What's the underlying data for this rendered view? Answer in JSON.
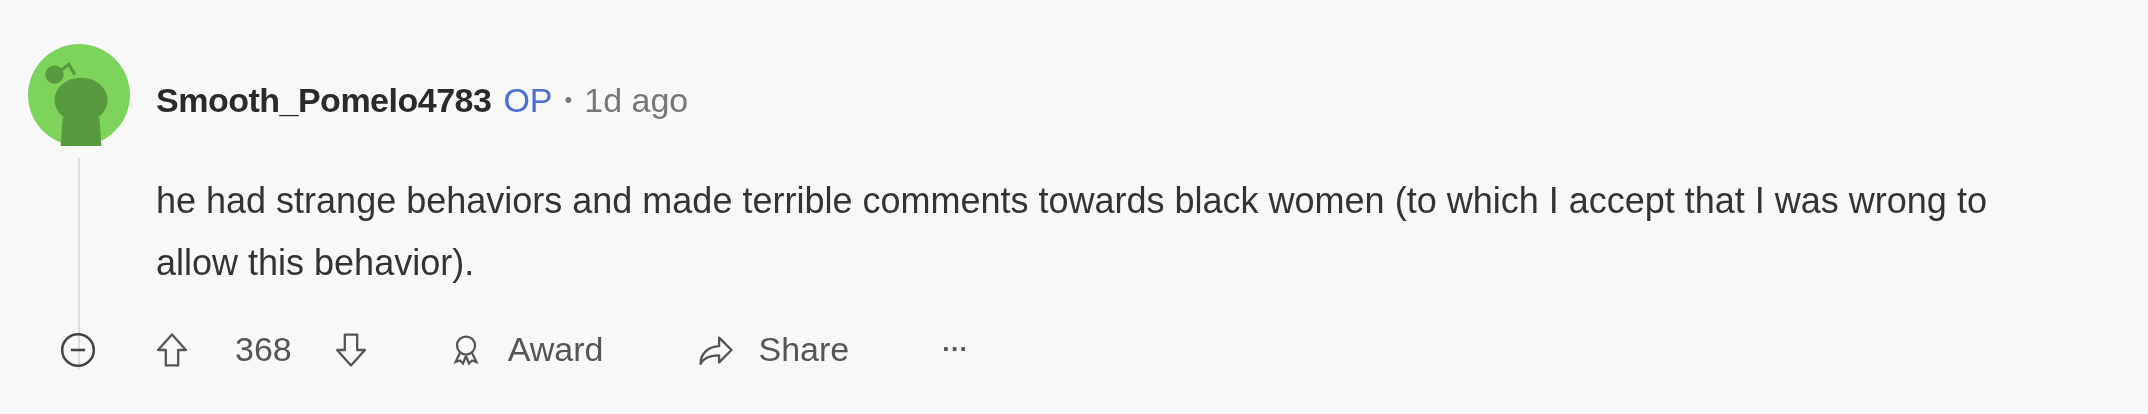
{
  "comment": {
    "author": "Smooth_Pomelo4783",
    "author_badge": "OP",
    "separator": "•",
    "time": "1d ago",
    "body": "he had strange behaviors and made terrible comments towards black women (to which I accept that I was wrong to allow this behavior).",
    "score": "368",
    "actions": [
      {
        "kind": "award",
        "label": "Award"
      },
      {
        "kind": "share",
        "label": "Share"
      },
      {
        "kind": "more",
        "label": "···"
      }
    ]
  }
}
